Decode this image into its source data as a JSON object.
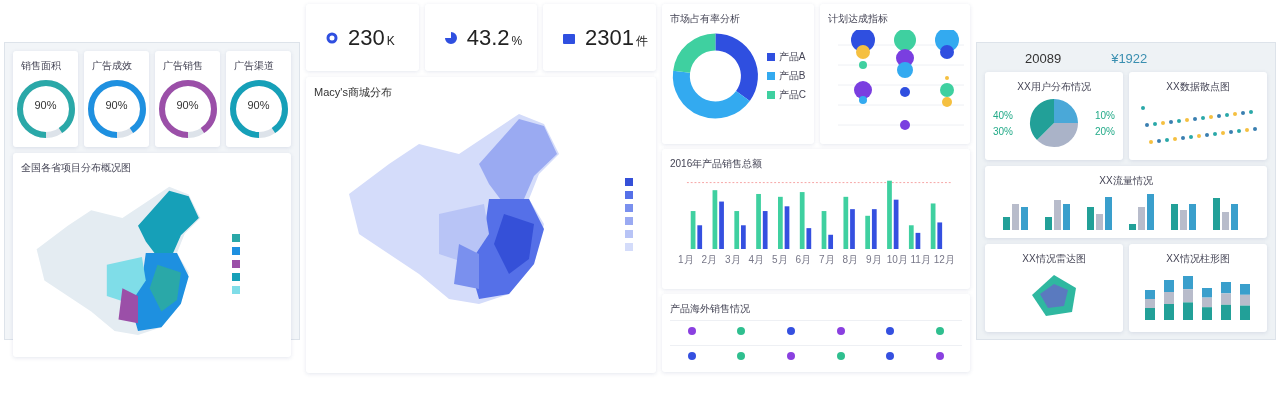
{
  "left_screen": {
    "gauges": [
      {
        "label": "销售面积",
        "value": "90%",
        "level": 0.9,
        "color": "#2aa8a8"
      },
      {
        "label": "广告成效",
        "value": "90%",
        "level": 0.9,
        "color": "#1e90e0"
      },
      {
        "label": "广告销售",
        "value": "90%",
        "level": 0.9,
        "color": "#9b4fa8"
      },
      {
        "label": "广告渠道",
        "value": "90%",
        "level": 0.9,
        "color": "#16a0b8"
      }
    ],
    "map_title": "全国各省项目分布概况图",
    "legend": [
      {
        "color": "#2aa8a8"
      },
      {
        "color": "#1e90e0"
      },
      {
        "color": "#9b4fa8"
      },
      {
        "color": "#16a0b8"
      },
      {
        "color": "#7fdde8"
      }
    ]
  },
  "kpis": [
    {
      "value": "230",
      "unit": "K",
      "kind": "ring"
    },
    {
      "value": "43.2",
      "unit": "%",
      "kind": "pie"
    },
    {
      "value": "2301",
      "unit": "件",
      "kind": "bag"
    }
  ],
  "map_card": {
    "title": "Macy's商城分布",
    "legend": [
      {
        "color": "#3550d8"
      },
      {
        "color": "#5570e8"
      },
      {
        "color": "#7a90ee"
      },
      {
        "color": "#9aaaf2"
      },
      {
        "color": "#b8c4f6"
      },
      {
        "color": "#d4dcfa"
      }
    ]
  },
  "share_card": {
    "title": "市场占有率分析",
    "legend": [
      {
        "label": "产品A",
        "color": "#2f4fe0"
      },
      {
        "label": "产品B",
        "color": "#33aaf0"
      },
      {
        "label": "产品C",
        "color": "#3fd0a0"
      }
    ]
  },
  "plan_card": {
    "title": "计划达成指标"
  },
  "sales_card": {
    "title": "2016年产品销售总额",
    "months": [
      "1月",
      "2月",
      "3月",
      "4月",
      "5月",
      "6月",
      "7月",
      "8月",
      "9月",
      "10月",
      "11月",
      "12月"
    ]
  },
  "overseas_card": {
    "title": "产品海外销售情况"
  },
  "right_screen": {
    "stats": [
      "20089",
      "¥1922"
    ],
    "pie_labels": [
      "40%",
      "10%",
      "30%",
      "20%"
    ],
    "panels": [
      {
        "title": "XX用户分布情况"
      },
      {
        "title": "XX数据散点图"
      },
      {
        "title": "XX流量情况"
      },
      {
        "title": "XX情况雷达图"
      },
      {
        "title": "XX情况柱形图"
      }
    ]
  }
}
